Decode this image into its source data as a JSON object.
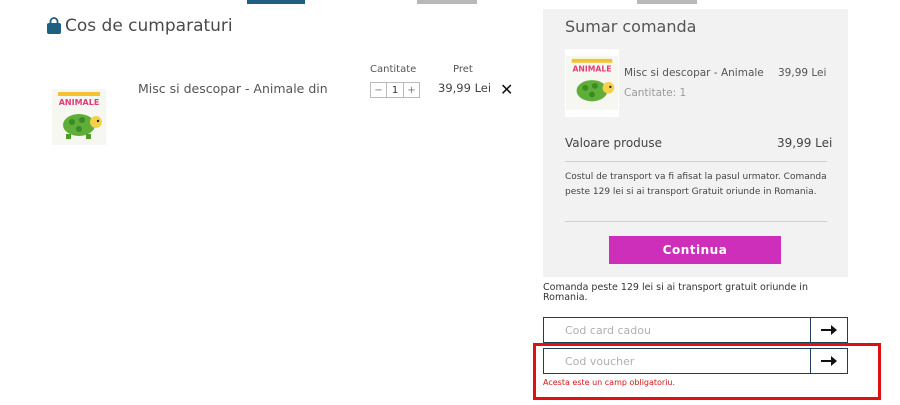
{
  "cart": {
    "title": "Cos de cumparaturi",
    "qty_header": "Cantitate",
    "price_header": "Pret",
    "item": {
      "name": "Misc si descopar - Animale din",
      "image_title": "ANIMALE",
      "quantity": "1",
      "minus": "−",
      "plus": "+",
      "price": "39,99 Lei",
      "remove": "✕"
    }
  },
  "summary": {
    "title": "Sumar comanda",
    "item_name": "Misc si descopar - Animale",
    "item_price": "39,99 Lei",
    "item_qty": "Cantitate: 1",
    "total_label": "Valoare produse",
    "total_value": "39,99 Lei",
    "shipping_note": "Costul de transport va fi afisat la pasul urmator. Comanda peste 129 lei si ai transport Gratuit oriunde in Romania.",
    "continue_label": "Continua"
  },
  "free_shipping_note": "Comanda peste 129 lei si ai transport gratuit oriunde in Romania.",
  "gift_card": {
    "placeholder": "Cod card cadou",
    "submit": "→"
  },
  "voucher": {
    "placeholder": "Cod voucher",
    "submit": "→",
    "error": "Acesta este un camp obligatoriu."
  },
  "colors": {
    "accent": "#cd2fbb",
    "border": "#1f3d5a",
    "error": "#e01010",
    "nav_active": "#1f5f82"
  },
  "icons": [
    "shopping-bag-icon",
    "close-icon",
    "arrow-right-icon"
  ]
}
